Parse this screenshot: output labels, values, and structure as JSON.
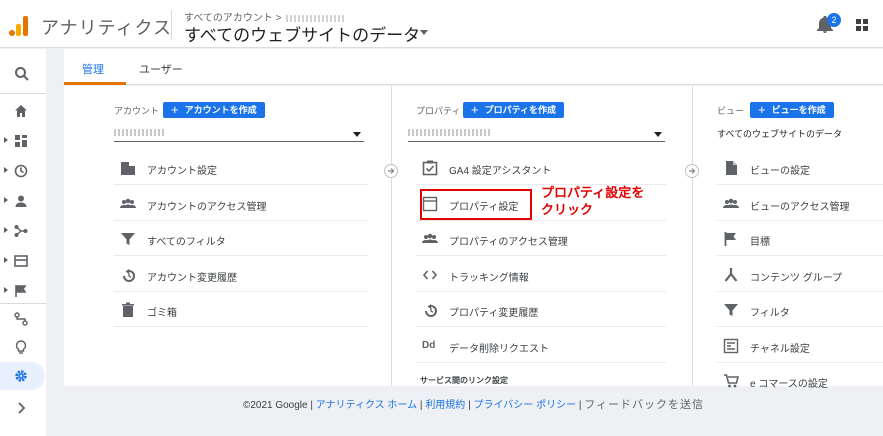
{
  "header": {
    "app_name": "アナリティクス",
    "breadcrumb": "すべてのアカウント >",
    "view_title": "すべてのウェブサイトのデータ",
    "notification_count": "2"
  },
  "tabs": [
    {
      "label": "管理",
      "active": true
    },
    {
      "label": "ユーザー",
      "active": false
    }
  ],
  "rail": {
    "icons": [
      "search-icon",
      "home-icon",
      "customization-icon",
      "realtime-icon",
      "audience-icon",
      "acquisition-icon",
      "behavior-icon",
      "conversions-icon",
      "attribution-icon",
      "discover-icon",
      "admin-icon",
      "expand-icon"
    ]
  },
  "columns": {
    "account": {
      "label": "アカウント",
      "create_button": "アカウントを作成",
      "items": [
        {
          "label": "アカウント設定",
          "icon": "building-icon"
        },
        {
          "label": "アカウントのアクセス管理",
          "icon": "people-icon"
        },
        {
          "label": "すべてのフィルタ",
          "icon": "filter-icon"
        },
        {
          "label": "アカウント変更履歴",
          "icon": "history-icon"
        },
        {
          "label": "ゴミ箱",
          "icon": "trash-icon"
        }
      ]
    },
    "property": {
      "label": "プロパティ",
      "create_button": "プロパティを作成",
      "items": [
        {
          "label": "GA4 設定アシスタント",
          "icon": "checkbox-icon"
        },
        {
          "label": "プロパティ設定",
          "icon": "window-icon"
        },
        {
          "label": "プロパティのアクセス管理",
          "icon": "people-icon"
        },
        {
          "label": "トラッキング情報",
          "icon": "code-icon"
        },
        {
          "label": "プロパティ変更履歴",
          "icon": "history-icon"
        },
        {
          "label": "データ削除リクエスト",
          "icon": "dd-icon"
        }
      ],
      "section_heading": "サービス間のリンク設定"
    },
    "view": {
      "label": "ビュー",
      "create_button": "ビューを作成",
      "selected": "すべてのウェブサイトのデータ",
      "items": [
        {
          "label": "ビューの設定",
          "icon": "document-icon"
        },
        {
          "label": "ビューのアクセス管理",
          "icon": "people-icon"
        },
        {
          "label": "目標",
          "icon": "flag-icon"
        },
        {
          "label": "コンテンツ グループ",
          "icon": "content-group-icon"
        },
        {
          "label": "フィルタ",
          "icon": "filter-icon"
        },
        {
          "label": "チャネル設定",
          "icon": "channel-icon"
        },
        {
          "label": "e コマースの設定",
          "icon": "cart-icon"
        }
      ]
    }
  },
  "annotation": {
    "line1": "プロパティ設定を",
    "line2": "クリック",
    "color": "#e30000"
  },
  "footer": {
    "copyright": "©2021 Google |",
    "link_home": "アナリティクス ホーム",
    "link_terms": "利用規約",
    "link_privacy": "プライバシー ポリシー",
    "feedback": "フィードバックを送信"
  },
  "colors": {
    "accent": "#1a73e8",
    "tab_indicator": "#e37400"
  }
}
